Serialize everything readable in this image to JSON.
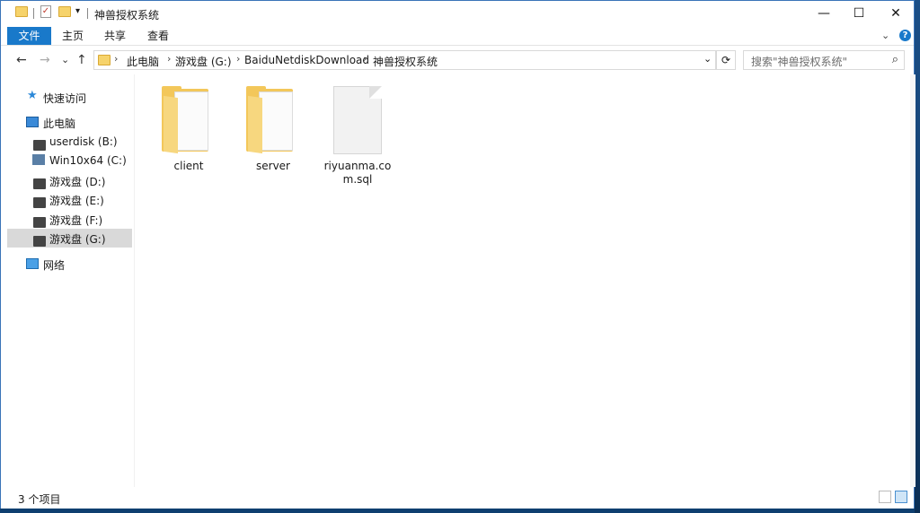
{
  "window": {
    "title": "神兽授权系统",
    "controls": {
      "minimize": "—",
      "maximize": "☐",
      "close": "✕"
    }
  },
  "quick_access_toolbar": {
    "dropdown_glyph": "▾"
  },
  "ribbon": {
    "tabs": [
      "文件",
      "主页",
      "共享",
      "查看"
    ],
    "help_glyph": "?",
    "collapse_glyph": "⌄"
  },
  "navigation": {
    "back_glyph": "←",
    "forward_glyph": "→",
    "recent_glyph": "⌄",
    "up_glyph": "↑"
  },
  "address": {
    "breadcrumbs": [
      "此电脑",
      "游戏盘 (G:)",
      "BaiduNetdiskDownload",
      "神兽授权系统"
    ],
    "separator": "›",
    "dropdown_glyph": "⌄",
    "refresh_glyph": "⟳"
  },
  "search": {
    "placeholder": "搜索\"神兽授权系统\"",
    "icon": "search-icon",
    "glyph": "⌕"
  },
  "nav_pane": {
    "quick_access": "快速访问",
    "this_pc": "此电脑",
    "drives": [
      {
        "label": "userdisk (B:)"
      },
      {
        "label": "Win10x64 (C:)"
      },
      {
        "label": "游戏盘 (D:)"
      },
      {
        "label": "游戏盘 (E:)"
      },
      {
        "label": "游戏盘 (F:)"
      },
      {
        "label": "游戏盘 (G:)",
        "selected": true
      }
    ],
    "network": "网络"
  },
  "files": [
    {
      "name": "client",
      "type": "folder"
    },
    {
      "name": "server",
      "type": "folder"
    },
    {
      "name": "riyuanma.com.sql",
      "type": "file"
    }
  ],
  "status": {
    "item_count": "3 个项目"
  },
  "colors": {
    "accent": "#1979ca",
    "folder": "#f3c75a",
    "selected_nav": "#d9d9d9"
  }
}
